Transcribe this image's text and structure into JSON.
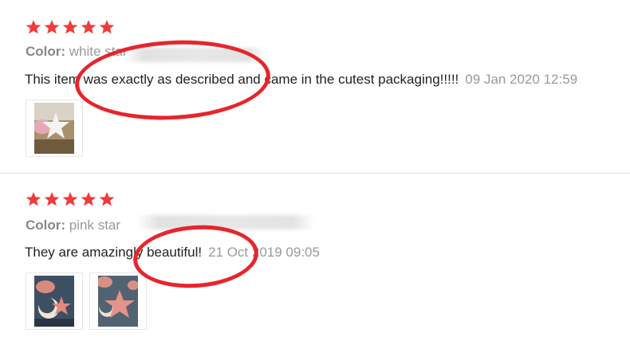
{
  "reviews": [
    {
      "rating": 5,
      "color_label": "Color:",
      "color_value": "white star",
      "text": "This item was exactly as described and came in the cutest packaging!!!!!",
      "date": "09 Jan 2020 12:59",
      "photos": [
        "review-photo-white-star"
      ]
    },
    {
      "rating": 5,
      "color_label": "Color:",
      "color_value": "pink star",
      "text": "They are amazingly beautiful!",
      "date": "21 Oct 2019 09:05",
      "photos": [
        "review-photo-pink-star-moon",
        "review-photo-pink-star-moon"
      ]
    }
  ],
  "colors": {
    "star": "#f23b3b",
    "annotation": "#e8242c",
    "date": "#9a9a9a",
    "divider": "#e3e3e3"
  },
  "icons": {
    "rating": "star-icon"
  }
}
